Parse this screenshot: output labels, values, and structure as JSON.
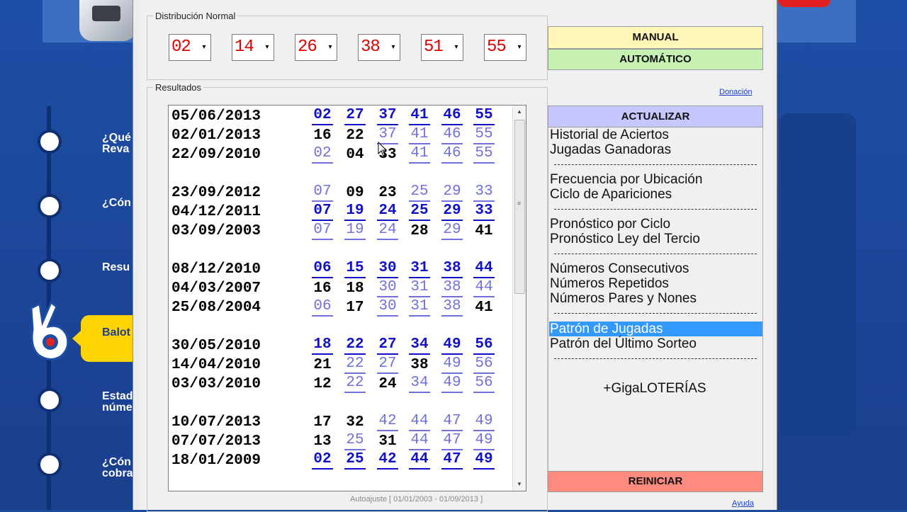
{
  "background": {
    "nav_items": [
      "¿Qué\nReva",
      "¿Cón",
      "Resu",
      "Balot",
      "Estad\nnúme",
      "¿Cón\ncobra"
    ],
    "accent_yellow": "#ffd400",
    "brand_blue": "#1d4ea6"
  },
  "distribution": {
    "legend": "Distribución Normal",
    "values": [
      "02",
      "14",
      "26",
      "38",
      "51",
      "55"
    ]
  },
  "buttons": {
    "manual": "MANUAL",
    "auto": "AUTOMÁTICO",
    "update": "ACTUALIZAR",
    "reset": "REINICIAR"
  },
  "links": {
    "donate": "Donación",
    "help": "Ayuda"
  },
  "results": {
    "legend": "Resultados",
    "footer": "Autoajuste [ 01/01/2003 - 01/09/2013 ]",
    "rows": [
      {
        "date": "05/06/2013",
        "nums": [
          [
            "02",
            "a"
          ],
          [
            "27",
            "a"
          ],
          [
            "37",
            "a"
          ],
          [
            "41",
            "a"
          ],
          [
            "46",
            "a"
          ],
          [
            "55",
            "a"
          ]
        ]
      },
      {
        "date": "02/01/2013",
        "nums": [
          [
            "16",
            "b"
          ],
          [
            "22",
            "b"
          ],
          [
            "37",
            "c"
          ],
          [
            "41",
            "c"
          ],
          [
            "46",
            "c"
          ],
          [
            "55",
            "c"
          ]
        ]
      },
      {
        "date": "22/09/2010",
        "nums": [
          [
            "02",
            "c"
          ],
          [
            "04",
            "b"
          ],
          [
            "33",
            "b"
          ],
          [
            "41",
            "c"
          ],
          [
            "46",
            "c"
          ],
          [
            "55",
            "c"
          ]
        ]
      },
      {
        "date": "23/09/2012",
        "nums": [
          [
            "07",
            "c"
          ],
          [
            "09",
            "b"
          ],
          [
            "23",
            "b"
          ],
          [
            "25",
            "c"
          ],
          [
            "29",
            "c"
          ],
          [
            "33",
            "c"
          ]
        ]
      },
      {
        "date": "04/12/2011",
        "nums": [
          [
            "07",
            "a"
          ],
          [
            "19",
            "a"
          ],
          [
            "24",
            "a"
          ],
          [
            "25",
            "a"
          ],
          [
            "29",
            "a"
          ],
          [
            "33",
            "a"
          ]
        ]
      },
      {
        "date": "03/09/2003",
        "nums": [
          [
            "07",
            "c"
          ],
          [
            "19",
            "c"
          ],
          [
            "24",
            "c"
          ],
          [
            "28",
            "b"
          ],
          [
            "29",
            "c"
          ],
          [
            "41",
            "b"
          ]
        ]
      },
      {
        "date": "08/12/2010",
        "nums": [
          [
            "06",
            "a"
          ],
          [
            "15",
            "a"
          ],
          [
            "30",
            "a"
          ],
          [
            "31",
            "a"
          ],
          [
            "38",
            "a"
          ],
          [
            "44",
            "a"
          ]
        ]
      },
      {
        "date": "04/03/2007",
        "nums": [
          [
            "16",
            "b"
          ],
          [
            "18",
            "b"
          ],
          [
            "30",
            "c"
          ],
          [
            "31",
            "c"
          ],
          [
            "38",
            "c"
          ],
          [
            "44",
            "c"
          ]
        ]
      },
      {
        "date": "25/08/2004",
        "nums": [
          [
            "06",
            "c"
          ],
          [
            "17",
            "b"
          ],
          [
            "30",
            "c"
          ],
          [
            "31",
            "c"
          ],
          [
            "38",
            "c"
          ],
          [
            "41",
            "b"
          ]
        ]
      },
      {
        "date": "30/05/2010",
        "nums": [
          [
            "18",
            "a"
          ],
          [
            "22",
            "a"
          ],
          [
            "27",
            "a"
          ],
          [
            "34",
            "a"
          ],
          [
            "49",
            "a"
          ],
          [
            "56",
            "a"
          ]
        ]
      },
      {
        "date": "14/04/2010",
        "nums": [
          [
            "21",
            "b"
          ],
          [
            "22",
            "c"
          ],
          [
            "27",
            "c"
          ],
          [
            "38",
            "b"
          ],
          [
            "49",
            "c"
          ],
          [
            "56",
            "c"
          ]
        ]
      },
      {
        "date": "03/03/2010",
        "nums": [
          [
            "12",
            "b"
          ],
          [
            "22",
            "c"
          ],
          [
            "24",
            "b"
          ],
          [
            "34",
            "c"
          ],
          [
            "49",
            "c"
          ],
          [
            "56",
            "c"
          ]
        ]
      },
      {
        "date": "10/07/2013",
        "nums": [
          [
            "17",
            "b"
          ],
          [
            "32",
            "b"
          ],
          [
            "42",
            "c"
          ],
          [
            "44",
            "c"
          ],
          [
            "47",
            "c"
          ],
          [
            "49",
            "c"
          ]
        ]
      },
      {
        "date": "07/07/2013",
        "nums": [
          [
            "13",
            "b"
          ],
          [
            "25",
            "c"
          ],
          [
            "31",
            "b"
          ],
          [
            "44",
            "c"
          ],
          [
            "47",
            "c"
          ],
          [
            "49",
            "c"
          ]
        ]
      },
      {
        "date": "18/01/2009",
        "nums": [
          [
            "02",
            "a"
          ],
          [
            "25",
            "a"
          ],
          [
            "42",
            "a"
          ],
          [
            "44",
            "a"
          ],
          [
            "47",
            "a"
          ],
          [
            "49",
            "a"
          ]
        ]
      }
    ]
  },
  "menu": {
    "items": [
      "Historial de Aciertos",
      "Jugadas Ganadoras",
      "Frecuencia por Ubicación",
      "Ciclo de Apariciones",
      "Pronóstico por Ciclo",
      "Pronóstico Ley del Tercio",
      "Números Consecutivos",
      "Números Repetidos",
      "Números Pares y Nones",
      "Patrón de Jugadas",
      "Patrón del Último Sorteo"
    ],
    "selected_index": 9,
    "separator": "------------------------------------",
    "giga": "+GigaLOTERÍAS"
  }
}
